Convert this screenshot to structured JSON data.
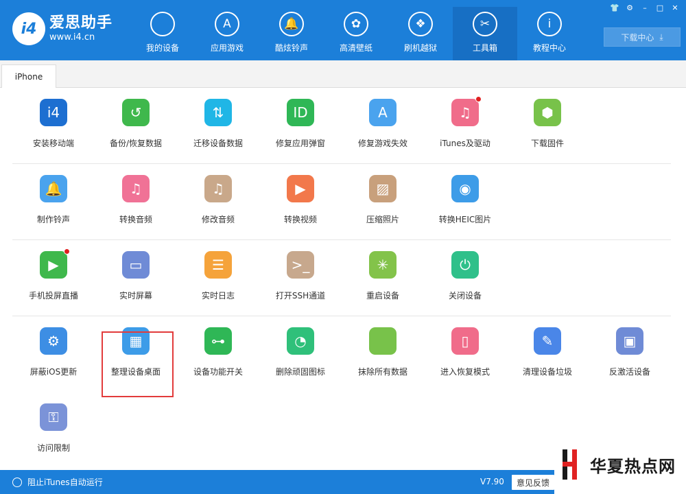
{
  "app": {
    "title": "爱思助手",
    "url": "www.i4.cn",
    "logo_text": "i4"
  },
  "nav": [
    {
      "label": "我的设备",
      "icon": "apple-icon",
      "glyph": ""
    },
    {
      "label": "应用游戏",
      "icon": "app-store-icon",
      "glyph": "A"
    },
    {
      "label": "酷炫铃声",
      "icon": "bell-icon",
      "glyph": "🔔"
    },
    {
      "label": "高清壁纸",
      "icon": "flower-icon",
      "glyph": "✿"
    },
    {
      "label": "刷机越狱",
      "icon": "dropbox-icon",
      "glyph": "❖"
    },
    {
      "label": "工具箱",
      "icon": "tools-icon",
      "glyph": "✂"
    },
    {
      "label": "教程中心",
      "icon": "info-icon",
      "glyph": "i"
    }
  ],
  "active_nav": "工具箱",
  "window_controls": [
    "👕",
    "⚙",
    "–",
    "□",
    "✕"
  ],
  "download": {
    "label": "下载中心",
    "icon": "⤓"
  },
  "tab": {
    "label": "iPhone"
  },
  "tools": [
    [
      {
        "label": "安装移动端",
        "color": "#1d6fd1",
        "glyph": "i4",
        "icon": "i4-logo-icon"
      },
      {
        "label": "备份/恢复数据",
        "color": "#3fb84c",
        "glyph": "↺",
        "icon": "backup-icon"
      },
      {
        "label": "迁移设备数据",
        "color": "#20b6e6",
        "glyph": "⇅",
        "icon": "migrate-icon"
      },
      {
        "label": "修复应用弹窗",
        "color": "#2fb756",
        "glyph": "ID",
        "icon": "apple-id-icon"
      },
      {
        "label": "修复游戏失效",
        "color": "#4aa3ee",
        "glyph": "A",
        "icon": "app-store-icon"
      },
      {
        "label": "iTunes及驱动",
        "color": "#f06c8a",
        "glyph": "♫",
        "icon": "itunes-icon",
        "dot": true
      },
      {
        "label": "下载固件",
        "color": "#78c24a",
        "glyph": "⬢",
        "icon": "firmware-box-icon"
      }
    ],
    [
      {
        "label": "制作铃声",
        "color": "#4aa3ee",
        "glyph": "🔔",
        "icon": "bell-plus-icon"
      },
      {
        "label": "转换音频",
        "color": "#f07296",
        "glyph": "♫",
        "icon": "music-convert-icon"
      },
      {
        "label": "修改音频",
        "color": "#c9a88a",
        "glyph": "♫",
        "icon": "music-edit-icon"
      },
      {
        "label": "转换视频",
        "color": "#f2784b",
        "glyph": "▶",
        "icon": "video-convert-icon"
      },
      {
        "label": "压缩照片",
        "color": "#c8a07c",
        "glyph": "▨",
        "icon": "photo-compress-icon"
      },
      {
        "label": "转换HEIC图片",
        "color": "#3d9ce8",
        "glyph": "◉",
        "icon": "heic-convert-icon"
      }
    ],
    [
      {
        "label": "手机投屏直播",
        "color": "#3fb84c",
        "glyph": "▶",
        "icon": "screen-mirror-icon",
        "dot": true
      },
      {
        "label": "实时屏幕",
        "color": "#6f8bd6",
        "glyph": "▭",
        "icon": "monitor-icon"
      },
      {
        "label": "实时日志",
        "color": "#f5a33b",
        "glyph": "☰",
        "icon": "log-icon"
      },
      {
        "label": "打开SSH通道",
        "color": "#c7a88d",
        "glyph": ">_",
        "icon": "terminal-icon"
      },
      {
        "label": "重启设备",
        "color": "#83c34a",
        "glyph": "✳",
        "icon": "restart-icon"
      },
      {
        "label": "关闭设备",
        "color": "#2fc08a",
        "glyph": "⏻",
        "icon": "power-icon"
      }
    ],
    [
      {
        "label": "屏蔽iOS更新",
        "color": "#3d8ee4",
        "glyph": "⚙",
        "icon": "block-update-icon"
      },
      {
        "label": "整理设备桌面",
        "color": "#3d9ce8",
        "glyph": "▦",
        "icon": "desktop-grid-icon"
      },
      {
        "label": "设备功能开关",
        "color": "#2fb756",
        "glyph": "⊶",
        "icon": "toggle-icon"
      },
      {
        "label": "删除顽固图标",
        "color": "#2fc07a",
        "glyph": "◔",
        "icon": "pie-icon"
      },
      {
        "label": "抹除所有数据",
        "color": "#78c24a",
        "glyph": "",
        "icon": "apple-erase-icon"
      },
      {
        "label": "进入恢复模式",
        "color": "#f06c8a",
        "glyph": "▯",
        "icon": "recovery-icon"
      },
      {
        "label": "清理设备垃圾",
        "color": "#4a86e8",
        "glyph": "✎",
        "icon": "broom-icon"
      },
      {
        "label": "反激活设备",
        "color": "#6f8bd6",
        "glyph": "▣",
        "icon": "deactivate-icon"
      }
    ],
    [
      {
        "label": "访问限制",
        "color": "#7b93d8",
        "glyph": "⚿",
        "icon": "restriction-key-icon"
      }
    ]
  ],
  "footer": {
    "itunes_label": "阻止iTunes自动运行",
    "version": "V7.90",
    "feedback": "意见反馈"
  },
  "watermark": {
    "text": "华夏热点网"
  }
}
